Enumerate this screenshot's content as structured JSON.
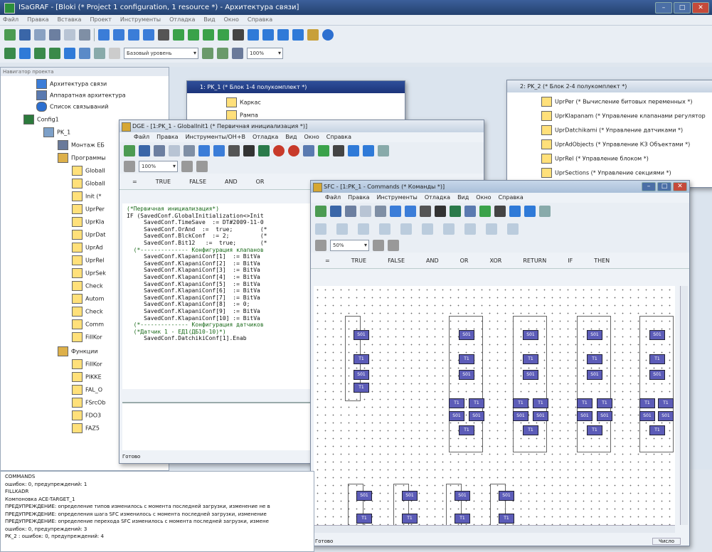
{
  "main_window": {
    "title": "ISaGRAF - [Bloki (* Project 1 configuration, 1 resource *) - Архитектура связи]",
    "menu": [
      "Файл",
      "Правка",
      "Вставка",
      "Проект",
      "Инструменты",
      "Отладка",
      "Вид",
      "Окно",
      "Справка"
    ],
    "toolbar2": {
      "combo1": "Базовый уровень",
      "combo2": "100%"
    }
  },
  "project_tree": {
    "header": "Навигатор проекта",
    "items": [
      "Архитектура связи",
      "Аппаратная архитектура",
      "Список связываний",
      "Config1",
      "PK_1",
      "Монтаж ЕБ",
      "Программы",
      "GlobalI",
      "GlobalI",
      "Init (*",
      "UprPer",
      "UprKla",
      "UprDat",
      "UprAd",
      "UprRel",
      "UprSek",
      "Check",
      "Autom",
      "Check",
      "Comm",
      "FillKor",
      "Функции",
      "FillKor",
      "PIKKE",
      "FAL_O",
      "FSrcOb",
      "FDO3",
      "FAZ5"
    ]
  },
  "window_pk1": {
    "title": "1: PK_1 (* Блок 1-4 полукомплект *)",
    "items": [
      "Каркас",
      "Рампа"
    ]
  },
  "window_pk2": {
    "title": "2: PK_2 (* Блок 2-4 полукомплект *)",
    "items": [
      "UprPer (* Вычисление битовых переменных *)",
      "UprKlapanam (* Управление клапанами регулятор",
      "UprDatchikami (* Управление датчиками *)",
      "UprAdObjects (* Управление КЗ Объектами *)",
      "UprRel (* Управление блоком *)",
      "UprSections (* Управление секциями *)"
    ]
  },
  "window_dge": {
    "title": "DGE - [1:PK_1 - GlobalInit1 (* Первичная инициализация *)]",
    "menu": [
      "Файл",
      "Правка",
      "Инструменты/ОН+В",
      "Отладка",
      "Вид",
      "Окно",
      "Справка"
    ],
    "combo": "100%",
    "ops": [
      "=",
      "TRUE",
      "FALSE",
      "AND",
      "OR"
    ],
    "code": [
      "(*Первичная инициализация*)",
      "IF (SavedConf.GlobalInitialization<>Init",
      "",
      "     SavedConf.TimeSave  := DT#2009-11-0",
      "",
      "     SavedConf.OrAnd  :=  true;        (*",
      "",
      "     SavedConf.BlckConf  := 2;         (*",
      "",
      "     SavedConf.Bit12   :=  true;       (*",
      "  (*-------------- Конфигурация клапанов",
      "     SavedConf.KlapaniConf[1]  := BitVa",
      "     SavedConf.KlapaniConf[2]  := BitVa",
      "     SavedConf.KlapaniConf[3]  := BitVa",
      "     SavedConf.KlapaniConf[4]  := BitVa",
      "     SavedConf.KlapaniConf[5]  := BitVa",
      "     SavedConf.KlapaniConf[6]  := BitVa",
      "     SavedConf.KlapaniConf[7]  := BitVa",
      "     SavedConf.KlapaniConf[8]  := 0;",
      "     SavedConf.KlapaniConf[9]  := BitVa",
      "     SavedConf.KlapaniConf[10] := BitVa",
      "",
      "  (*-------------- Конфигурация датчиков",
      "  (*Датчик 1 - ЕД1(ДБ10-10)*)",
      "     SavedConf.DatchikiConf[1].Enab"
    ],
    "status": "Готово"
  },
  "window_sfc": {
    "title": "SFC - [1:PK_1 - Commands (* Команды *)]",
    "menu": [
      "Файл",
      "Правка",
      "Инструменты",
      "Отладка",
      "Вид",
      "Окно",
      "Справка"
    ],
    "combo": "50%",
    "ops": [
      "=",
      "TRUE",
      "FALSE",
      "AND",
      "OR",
      "XOR",
      "RETURN",
      "IF",
      "THEN"
    ],
    "step_label": "S01",
    "trans_label": "T1",
    "status_left": "Готово",
    "status_right": "Число"
  },
  "output": {
    "lines": [
      "COMMANDS",
      "   ошибок: 0, предупреждений: 1",
      "FILLKADR",
      "Компоновка ACE-TARGET_1",
      "ПРЕДУПРЕЖДЕНИЕ: определение типов изменилось с момента последней загрузки, изменение не в",
      "ПРЕДУПРЕЖДЕНИЕ: определения шага SFC изменилось с момента последней загрузки, изменение",
      "ПРЕДУПРЕЖДЕНИЕ: определение перехода SFC изменилось с момента последней загрузки, измене",
      "   ошибок: 0, предупреждений: 3",
      "PK_2 : ошибок: 0, предупреждений: 4"
    ]
  },
  "colors": {
    "titlebar": "#2b4a80",
    "step": "#5c5cb8",
    "sfc_icon": "#d6a733"
  }
}
